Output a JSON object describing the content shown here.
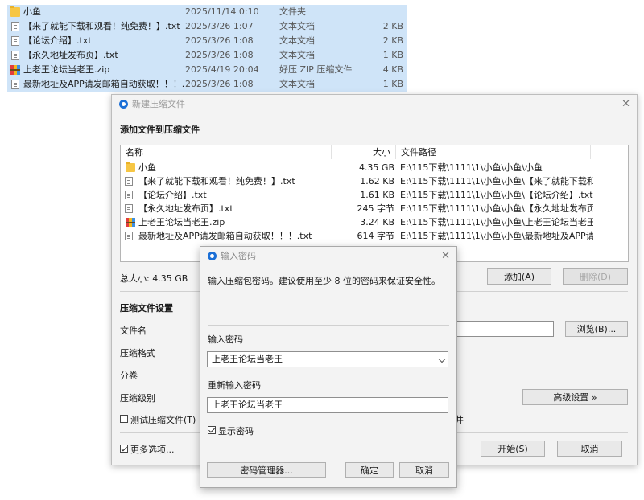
{
  "explorer": {
    "rows": [
      {
        "name": "小鱼",
        "date": "2025/11/14 0:10",
        "type": "文件夹",
        "size": "",
        "icon": "folder-icon"
      },
      {
        "name": "【来了就能下载和观看！纯免费！】.txt",
        "date": "2025/3/26 1:07",
        "type": "文本文档",
        "size": "2 KB",
        "icon": "text-file-icon"
      },
      {
        "name": "【论坛介绍】.txt",
        "date": "2025/3/26 1:08",
        "type": "文本文档",
        "size": "2 KB",
        "icon": "text-file-icon"
      },
      {
        "name": "【永久地址发布页】.txt",
        "date": "2025/3/26 1:08",
        "type": "文本文档",
        "size": "1 KB",
        "icon": "text-file-icon"
      },
      {
        "name": "上老王论坛当老王.zip",
        "date": "2025/4/19 20:04",
        "type": "好压 ZIP 压缩文件",
        "size": "4 KB",
        "icon": "zip-file-icon"
      },
      {
        "name": "最新地址及APP请发邮箱自动获取！！！....",
        "date": "2025/3/26 1:08",
        "type": "文本文档",
        "size": "1 KB",
        "icon": "text-file-icon"
      }
    ]
  },
  "main_dialog": {
    "title": "新建压缩文件",
    "section_add": "添加文件到压缩文件",
    "headers": {
      "name": "名称",
      "size": "大小",
      "path": "文件路径"
    },
    "files": [
      {
        "name": "小鱼",
        "size": "4.35 GB",
        "path": "E:\\115下载\\1111\\1\\小鱼\\小鱼\\小鱼",
        "icon": "folder-icon"
      },
      {
        "name": "【来了就能下载和观看！纯免费！】.txt",
        "size": "1.62 KB",
        "path": "E:\\115下载\\1111\\1\\小鱼\\小鱼\\【来了就能下载和...",
        "icon": "text-file-icon"
      },
      {
        "name": "【论坛介绍】.txt",
        "size": "1.61 KB",
        "path": "E:\\115下载\\1111\\1\\小鱼\\小鱼\\【论坛介绍】.txt",
        "icon": "text-file-icon"
      },
      {
        "name": "【永久地址发布页】.txt",
        "size": "245 字节",
        "path": "E:\\115下载\\1111\\1\\小鱼\\小鱼\\【永久地址发布页...",
        "icon": "text-file-icon"
      },
      {
        "name": "上老王论坛当老王.zip",
        "size": "3.24 KB",
        "path": "E:\\115下载\\1111\\1\\小鱼\\小鱼\\上老王论坛当老王...",
        "icon": "zip-file-icon"
      },
      {
        "name": "最新地址及APP请发邮箱自动获取！！！.txt",
        "size": "614 字节",
        "path": "E:\\115下载\\1111\\1\\小鱼\\小鱼\\最新地址及APP请...",
        "icon": "text-file-icon"
      }
    ],
    "total_size": "总大小: 4.35 GB",
    "add_button": "添加(A)",
    "delete_button": "删除(D)",
    "settings_title": "压缩文件设置",
    "label_filename": "文件名",
    "label_format": "压缩格式",
    "label_split": "分卷",
    "label_level": "压缩级别",
    "test_checkbox": "测试压缩文件(T)",
    "more_options": "更多选项...",
    "browse_button": "浏览(B)...",
    "advanced_button": "高级设置 »",
    "start_button": "开始(S)",
    "cancel_button": "取消",
    "partial_text": "井"
  },
  "password_dialog": {
    "title": "输入密码",
    "description": "输入压缩包密码。建议使用至少 8 位的密码来保证安全性。",
    "label_password": "输入密码",
    "password_value": "上老王论坛当老王",
    "label_repeat": "重新输入密码",
    "repeat_value": "上老王论坛当老王",
    "show_password": "显示密码",
    "manager_button": "密码管理器...",
    "ok_button": "确定",
    "cancel_button": "取消"
  }
}
